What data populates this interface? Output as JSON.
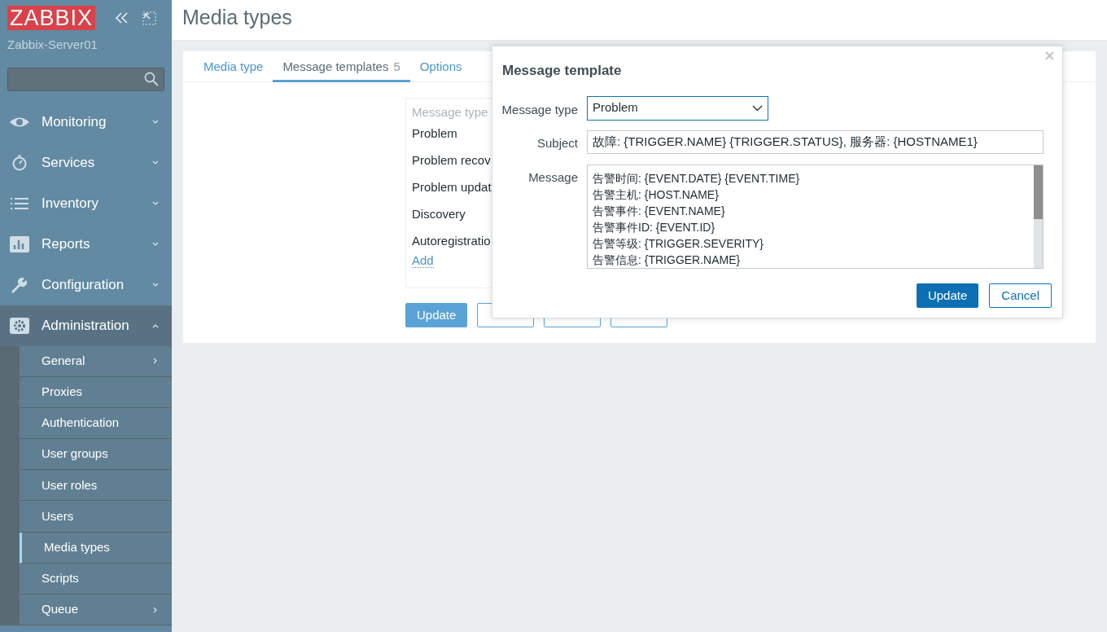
{
  "logo": "ZABBIX",
  "server_name": "Zabbix-Server01",
  "menu": [
    {
      "label": "Monitoring",
      "expanded": false
    },
    {
      "label": "Services",
      "expanded": false
    },
    {
      "label": "Inventory",
      "expanded": false
    },
    {
      "label": "Reports",
      "expanded": false
    },
    {
      "label": "Configuration",
      "expanded": false
    },
    {
      "label": "Administration",
      "expanded": true,
      "children": [
        {
          "label": "General",
          "submenu": true,
          "selected": false
        },
        {
          "label": "Proxies",
          "submenu": false,
          "selected": false
        },
        {
          "label": "Authentication",
          "submenu": false,
          "selected": false
        },
        {
          "label": "User groups",
          "submenu": false,
          "selected": false
        },
        {
          "label": "User roles",
          "submenu": false,
          "selected": false
        },
        {
          "label": "Users",
          "submenu": false,
          "selected": false
        },
        {
          "label": "Media types",
          "submenu": false,
          "selected": true
        },
        {
          "label": "Scripts",
          "submenu": false,
          "selected": false
        },
        {
          "label": "Queue",
          "submenu": true,
          "selected": false
        }
      ]
    }
  ],
  "page_title": "Media types",
  "tabs": [
    {
      "label": "Media type",
      "selected": false
    },
    {
      "label": "Message templates",
      "count": "5",
      "selected": true
    },
    {
      "label": "Options",
      "selected": false
    }
  ],
  "template_list": {
    "header": "Message type",
    "items": [
      "Problem",
      "Problem recov",
      "Problem updat",
      "Discovery",
      "Autoregistratio"
    ],
    "add_link": "Add"
  },
  "form_buttons": [
    {
      "label": "Update",
      "kind": "primary"
    },
    {
      "kind": "secondary"
    },
    {
      "kind": "secondary"
    },
    {
      "kind": "secondary"
    }
  ],
  "dialog": {
    "title": "Message template",
    "message_type": {
      "label": "Message type",
      "value": "Problem"
    },
    "subject": {
      "label": "Subject",
      "value": "故障: {TRIGGER.NAME} {TRIGGER.STATUS}, 服务器: {HOSTNAME1}"
    },
    "message": {
      "label": "Message",
      "lines": [
        "告警时间: {EVENT.DATE} {EVENT.TIME}",
        "告警主机: {HOST.NAME}",
        "告警事件: {EVENT.NAME}",
        "告警事件ID: {EVENT.ID}",
        "告警等级: {TRIGGER.SEVERITY}",
        "告警信息: {TRIGGER.NAME}"
      ]
    },
    "buttons": [
      {
        "label": "Update",
        "kind": "primary"
      },
      {
        "label": "Cancel",
        "kind": "secondary"
      }
    ]
  }
}
